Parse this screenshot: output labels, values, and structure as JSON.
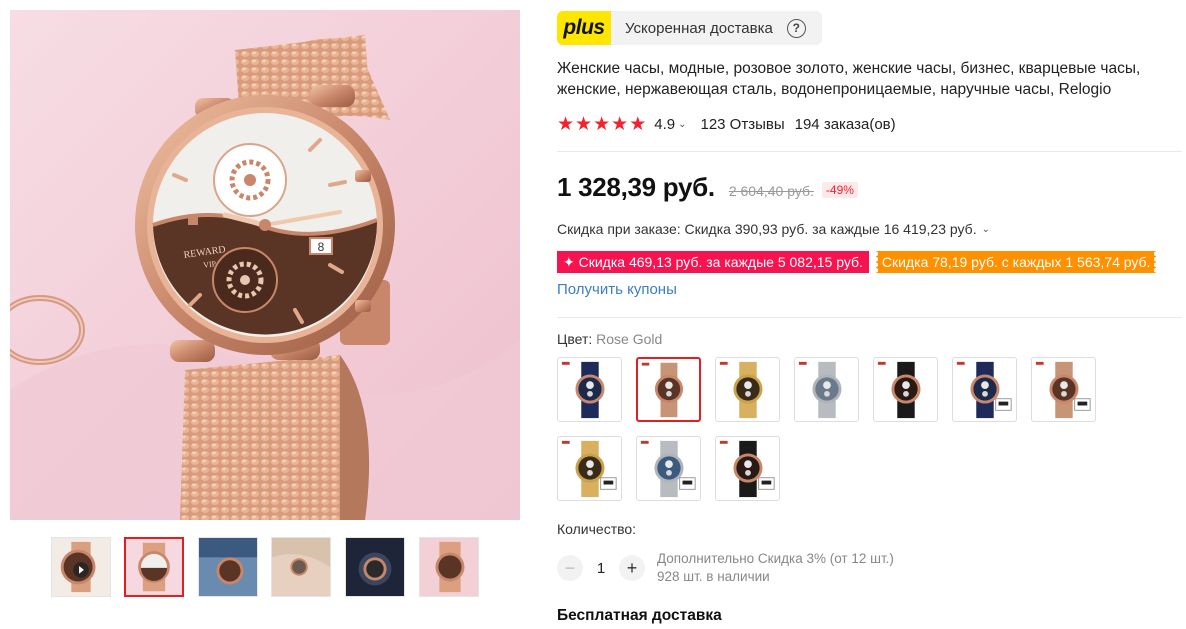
{
  "gallery": {
    "main_watch": {
      "dial_top_color": "#f2f2f0",
      "dial_bottom_color": "#5a3424",
      "case_color": "#c8866a",
      "brand": "REWARD",
      "sub_brand": "VIP",
      "date": "8"
    },
    "thumbnails": [
      {
        "name": "thumb-1",
        "dial": "#5a3424",
        "bg": "#f3ece6",
        "video": true
      },
      {
        "name": "thumb-2",
        "dial": "#5a3424",
        "bg": "#f6d8e0",
        "active": true
      },
      {
        "name": "thumb-3",
        "dial": "#5a3424",
        "bg": "#6a8bb0"
      },
      {
        "name": "thumb-4",
        "dial": "#6a5a50",
        "bg": "#d8c2ae"
      },
      {
        "name": "thumb-5",
        "dial": "#2a2a2a",
        "bg": "#2a3550"
      },
      {
        "name": "thumb-6",
        "dial": "#5a3424",
        "bg": "#f3cfd6"
      }
    ]
  },
  "plus": {
    "badge": "plus",
    "text": "Ускоренная доставка",
    "help_icon": "?"
  },
  "product": {
    "title": "Женские часы, модные, розовое золото, женские часы, бизнес, кварцевые часы, женские, нержавеющая сталь, водонепроницаемые, наручные часы, Relogio",
    "rating": "4.9",
    "stars": 5,
    "reviews": "123 Отзывы",
    "orders": "194 заказа(ов)"
  },
  "price": {
    "current": "1 328,39 руб.",
    "old": "2 604,40 руб.",
    "discount": "-49%"
  },
  "order_discount": "Скидка при заказе: Скидка 390,93 руб. за каждые 16 419,23 руб.",
  "coupons": [
    {
      "text": "✦ Скидка 469,13 руб. за каждые 5 082,15 руб.",
      "color": "#f7134f"
    },
    {
      "text": "Скидка 78,19 руб. с каждых 1 563,74 руб.",
      "color": "#ff9000"
    }
  ],
  "get_coupons": "Получить купоны",
  "color": {
    "label": "Цвет:",
    "value": "Rose Gold",
    "options": [
      {
        "name": "swatch-1",
        "dial": "#1d2a4a",
        "band": "#1d2a5a",
        "case": "#c8866a",
        "box": false
      },
      {
        "name": "swatch-2",
        "dial": "#5a3424",
        "band": "#c89478",
        "case": "#c8866a",
        "box": false,
        "selected": true
      },
      {
        "name": "swatch-3",
        "dial": "#3a2a18",
        "band": "#d8b060",
        "case": "#c9a24a",
        "box": false
      },
      {
        "name": "swatch-4",
        "dial": "#6a7a8a",
        "band": "#b8bcc0",
        "case": "#b0b4b8",
        "box": false
      },
      {
        "name": "swatch-5",
        "dial": "#2a1a14",
        "band": "#1a1a1a",
        "case": "#c8866a",
        "box": false
      },
      {
        "name": "swatch-6",
        "dial": "#1d2a4a",
        "band": "#1d2a5a",
        "case": "#c8866a",
        "box": true
      },
      {
        "name": "swatch-7",
        "dial": "#5a3424",
        "band": "#c89478",
        "case": "#c8866a",
        "box": true
      },
      {
        "name": "swatch-8",
        "dial": "#3a2a18",
        "band": "#d8b060",
        "case": "#c9a24a",
        "box": true
      },
      {
        "name": "swatch-9",
        "dial": "#3a5a80",
        "band": "#b8bcc0",
        "case": "#b0b4b8",
        "box": true
      },
      {
        "name": "swatch-10",
        "dial": "#2a1a14",
        "band": "#1a1a1a",
        "case": "#c8866a",
        "box": true
      }
    ]
  },
  "quantity": {
    "label": "Количество:",
    "value": "1",
    "minus": "−",
    "plus": "+",
    "extra_discount": "Дополнительно Скидка 3% (от 12 шт.)",
    "stock": "928 шт. в наличии"
  },
  "shipping": {
    "title": "Бесплатная доставка"
  }
}
